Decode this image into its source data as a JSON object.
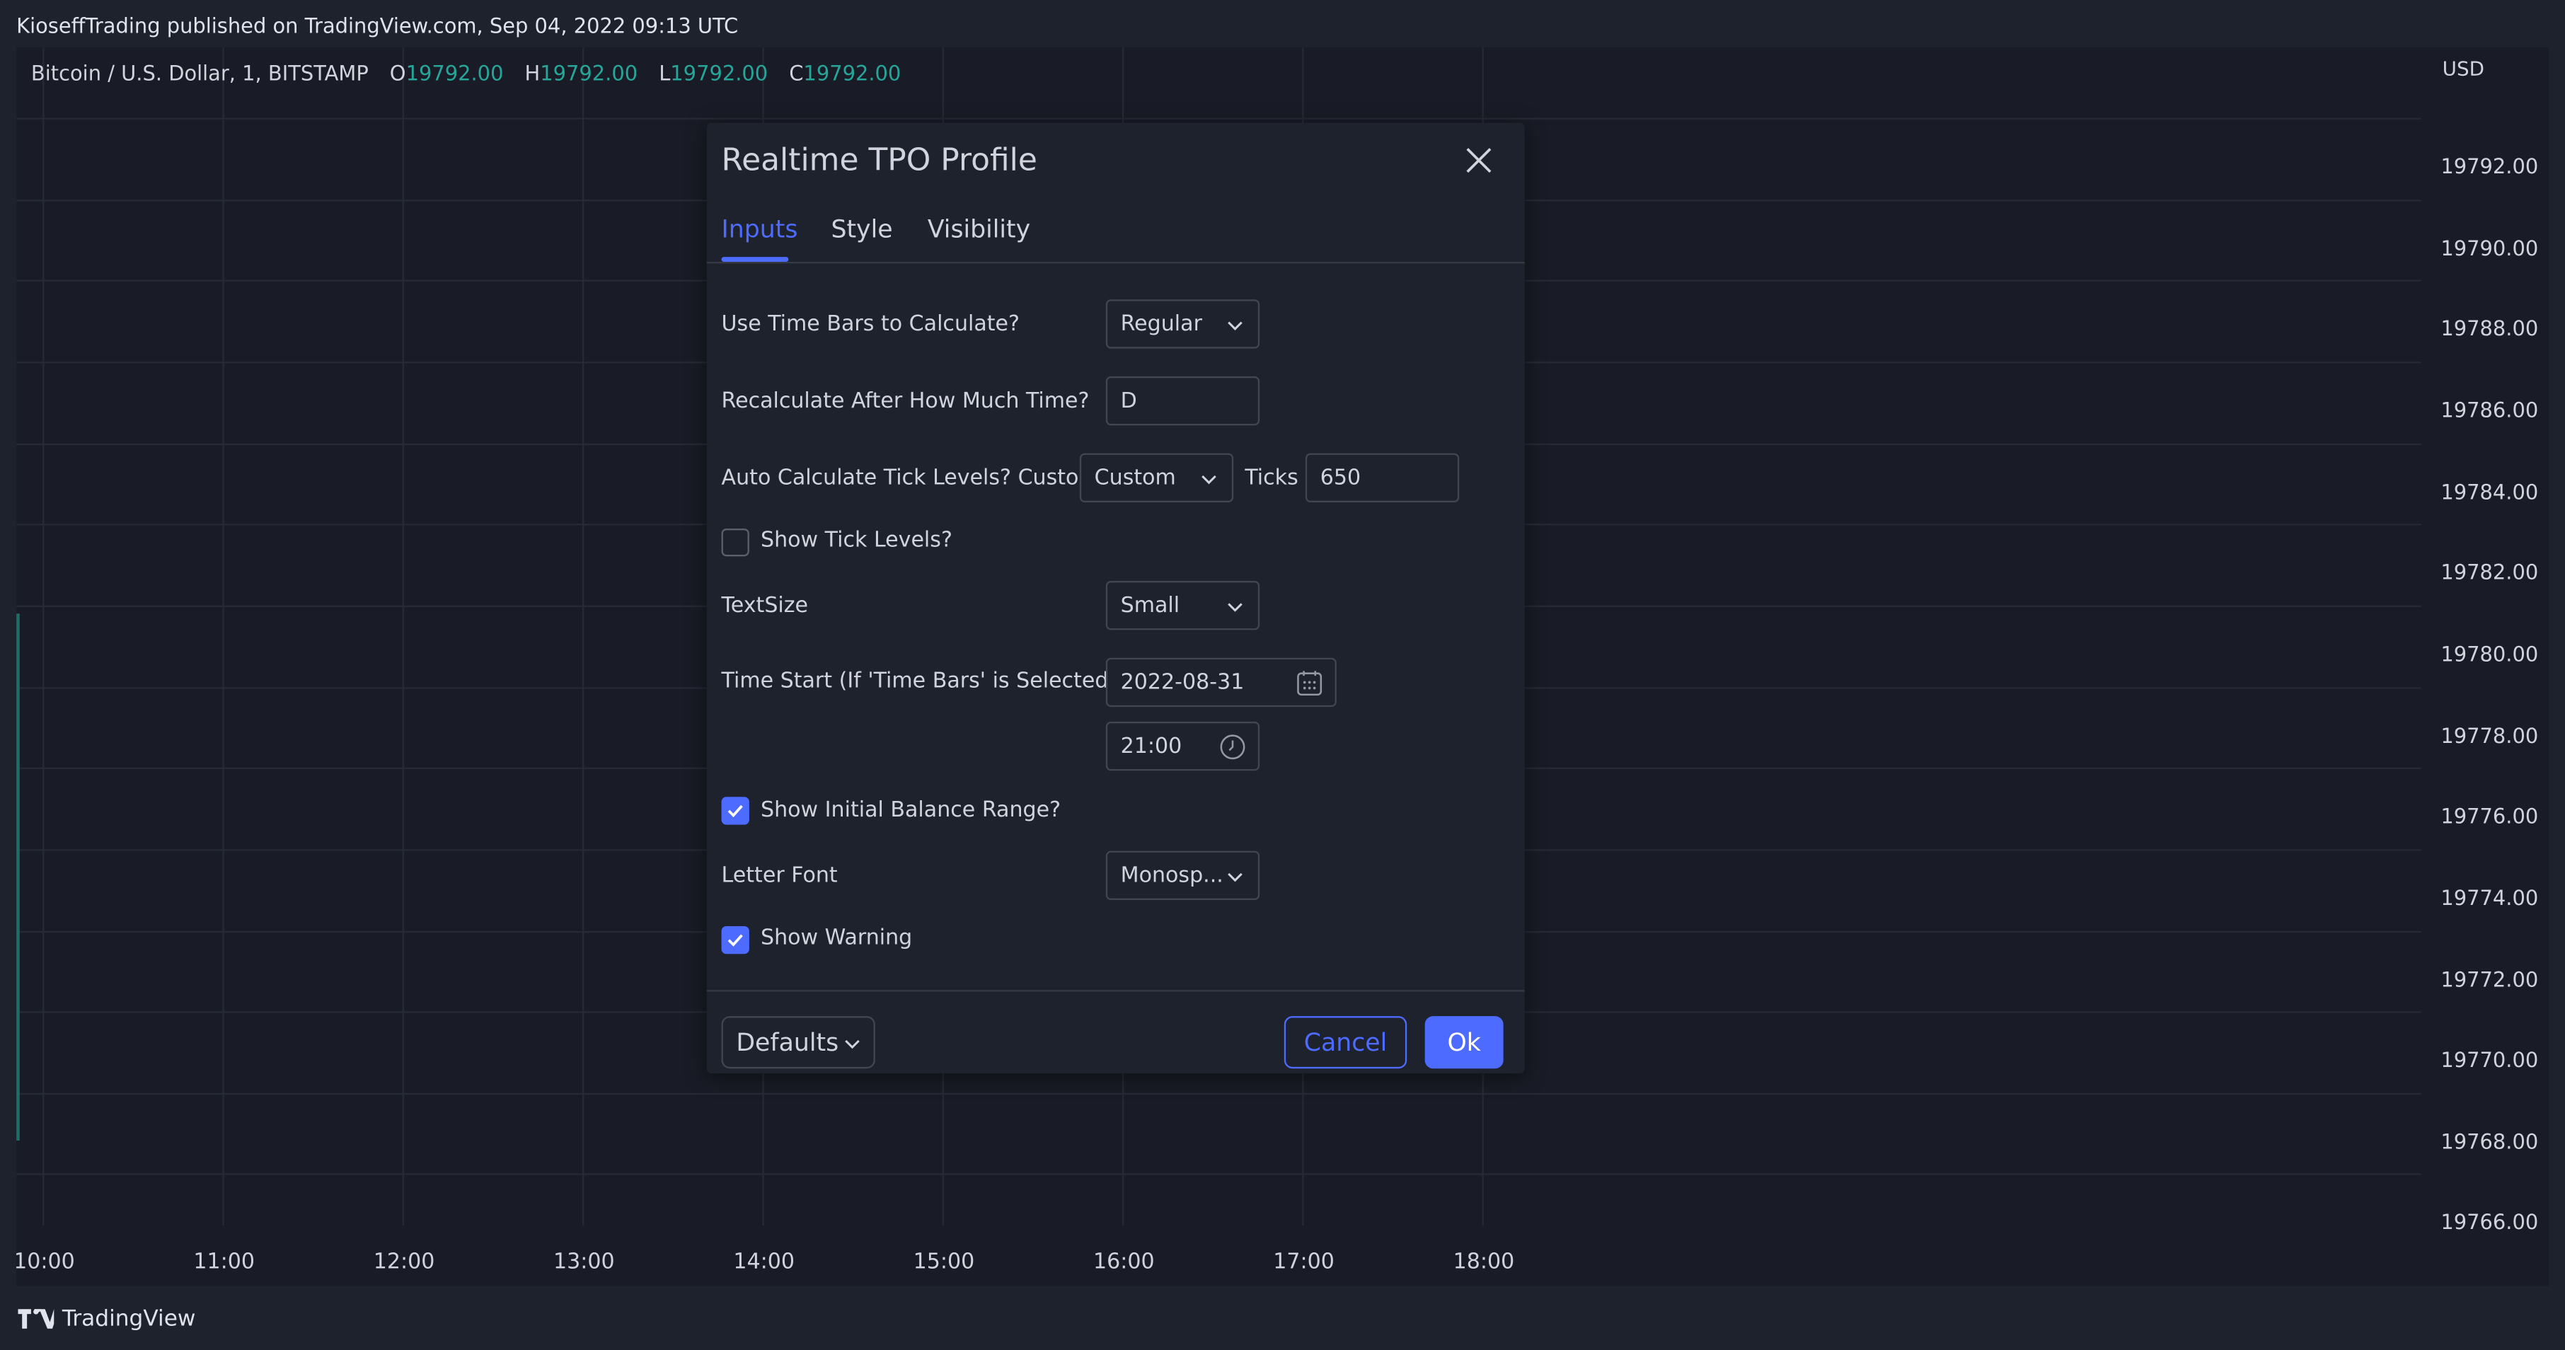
{
  "header": {
    "published": "KioseffTrading published on TradingView.com, Sep 04, 2022 09:13 UTC"
  },
  "legend": {
    "symbol": "Bitcoin / U.S. Dollar, 1, BITSTAMP",
    "o_key": "O",
    "o_val": "19792.00",
    "h_key": "H",
    "h_val": "19792.00",
    "l_key": "L",
    "l_val": "19792.00",
    "c_key": "C",
    "c_val": "19792.00",
    "value_color": "#26a69a"
  },
  "price_axis": {
    "currency": "USD",
    "labels": [
      "19792.00",
      "19790.00",
      "19788.00",
      "19786.00",
      "19784.00",
      "19782.00",
      "19780.00",
      "19778.00",
      "19776.00",
      "19774.00",
      "19772.00",
      "19770.00",
      "19768.00",
      "19766.00"
    ]
  },
  "time_axis": {
    "labels": [
      "10:00",
      "11:00",
      "12:00",
      "13:00",
      "14:00",
      "15:00",
      "16:00",
      "17:00",
      "18:00"
    ]
  },
  "footer": {
    "brand": "TradingView"
  },
  "dialog": {
    "title": "Realtime TPO Profile",
    "tabs": [
      "Inputs",
      "Style",
      "Visibility"
    ],
    "active_tab": "Inputs",
    "inputs": {
      "time_bars_label": "Use Time Bars to Calculate?",
      "time_bars_value": "Regular",
      "recalc_label": "Recalculate After How Much Time?",
      "recalc_value": "D",
      "tick_levels_label": "Auto Calculate Tick Levels? Custom?",
      "tick_levels_value": "Custom",
      "ticks_label": "Ticks",
      "ticks_value": "650",
      "show_tick_levels_label": "Show Tick Levels?",
      "show_tick_levels_checked": false,
      "textsize_label": "TextSize",
      "textsize_value": "Small",
      "time_start_label": "Time Start (If 'Time Bars' is Selected)",
      "time_start_date": "2022-08-31",
      "time_start_time": "21:00",
      "initial_balance_label": "Show Initial Balance Range?",
      "initial_balance_checked": true,
      "letter_font_label": "Letter Font",
      "letter_font_value": "Monosp...",
      "show_warning_label": "Show Warning",
      "show_warning_checked": true
    },
    "footer": {
      "defaults": "Defaults",
      "cancel": "Cancel",
      "ok": "Ok"
    },
    "accent_color": "#4d6bfe"
  }
}
